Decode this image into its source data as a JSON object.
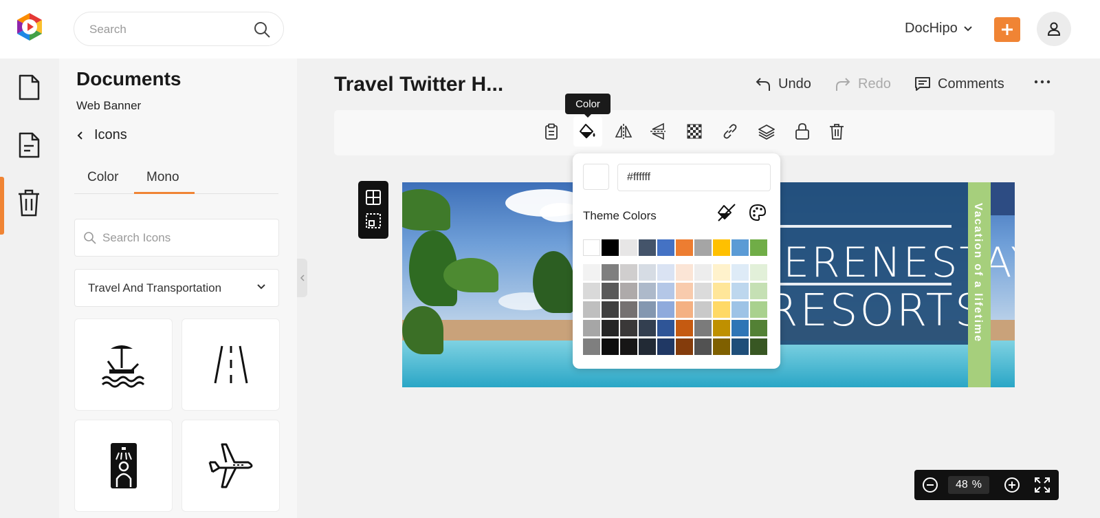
{
  "header": {
    "search_placeholder": "Search",
    "account_name": "DocHipo",
    "brand_colors": {
      "orange": "#f08434"
    }
  },
  "rail": {
    "items": [
      {
        "icon": "document-icon"
      },
      {
        "icon": "document-text-icon",
        "active": true
      },
      {
        "icon": "trash-icon"
      }
    ]
  },
  "panel": {
    "title": "Documents",
    "subtitle": "Web Banner",
    "back_label": "Icons",
    "tabs": [
      {
        "label": "Color"
      },
      {
        "label": "Mono",
        "active": true
      }
    ],
    "search_placeholder": "Search Icons",
    "category": "Travel And Transportation",
    "icons": [
      "beach-lounger-icon",
      "road-icon",
      "shower-icon",
      "airplane-icon"
    ]
  },
  "document": {
    "title": "Travel Twitter H...",
    "undo_label": "Undo",
    "redo_label": "Redo",
    "comments_label": "Comments"
  },
  "toolbar": {
    "tooltip": "Color",
    "tools": [
      "clipboard-icon",
      "paint-bucket-icon",
      "flip-horizontal-icon",
      "flip-vertical-icon",
      "transparency-icon",
      "link-icon",
      "layers-icon",
      "lock-icon",
      "trash-icon"
    ]
  },
  "banner": {
    "line1": "SERENESTAY",
    "line2": "RESORTS",
    "tagline": "Vacation of a lifetime"
  },
  "color_popover": {
    "hex_value": "#ffffff",
    "theme_label": "Theme Colors",
    "base_colors": [
      "#ffffff",
      "#000000",
      "#e7e6e6",
      "#44546a",
      "#4472c4",
      "#ed7d31",
      "#a5a5a5",
      "#ffc000",
      "#5b9bd5",
      "#70ad47"
    ],
    "shade_rows": [
      [
        "#f2f2f2",
        "#7f7f7f",
        "#d0cece",
        "#d6dce4",
        "#dae3f3",
        "#fbe5d6",
        "#ededed",
        "#fff2cc",
        "#deebf7",
        "#e2f0d9"
      ],
      [
        "#d9d9d9",
        "#595959",
        "#aeaaaa",
        "#adb9ca",
        "#b4c7e7",
        "#f8cbad",
        "#dbdbdb",
        "#ffe699",
        "#bdd7ee",
        "#c5e0b4"
      ],
      [
        "#bfbfbf",
        "#404040",
        "#757171",
        "#8497b0",
        "#8faadc",
        "#f4b183",
        "#c9c9c9",
        "#ffd966",
        "#9dc3e6",
        "#a9d18e"
      ],
      [
        "#a6a6a6",
        "#262626",
        "#3a3838",
        "#333f50",
        "#2f5597",
        "#c55a11",
        "#7b7b7b",
        "#bf9000",
        "#2e75b6",
        "#538135"
      ],
      [
        "#7f7f7f",
        "#0d0d0d",
        "#171616",
        "#222a35",
        "#203864",
        "#843c0c",
        "#525252",
        "#7f6000",
        "#1f4e79",
        "#385723"
      ]
    ]
  },
  "zoom": {
    "value": "48",
    "unit": "%"
  }
}
